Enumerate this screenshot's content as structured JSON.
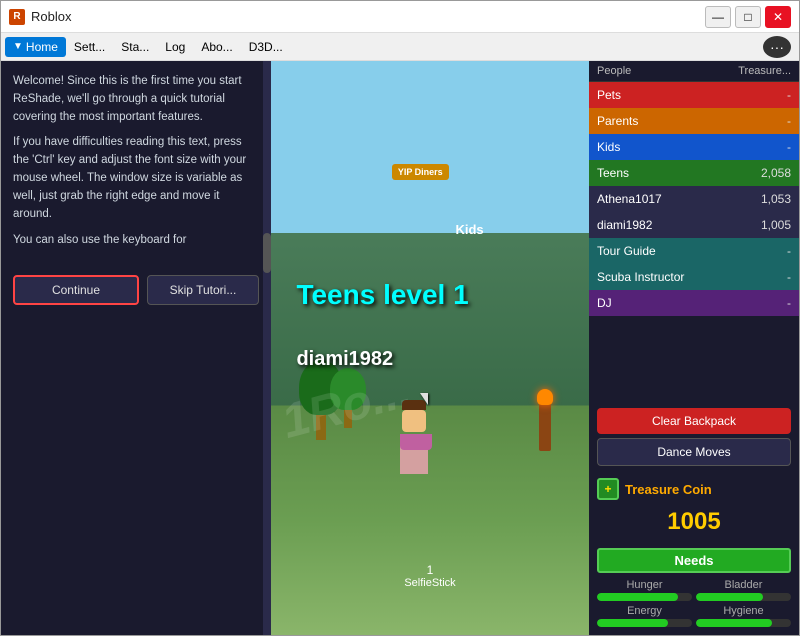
{
  "window": {
    "title": "Roblox",
    "icon": "R",
    "controls": {
      "minimize": "—",
      "maximize": "□",
      "close": "✕"
    }
  },
  "menu": {
    "tabs": [
      {
        "label": "Home",
        "active": true
      },
      {
        "label": "Sett..."
      },
      {
        "label": "Sta..."
      },
      {
        "label": "Log"
      },
      {
        "label": "Abo..."
      },
      {
        "label": "D3D..."
      }
    ],
    "more_btn": "···"
  },
  "left_panel": {
    "tutorial_paragraphs": [
      "Welcome! Since this is the first time you start ReShade, we'll go through a quick tutorial covering the most important features.",
      "If you have difficulties reading this text, press the 'Ctrl' key and adjust the font size with your mouse wheel. The window size is variable as well, just grab the right edge and move it around.",
      "You can also use the keyboard for"
    ],
    "btn_continue": "Continue",
    "btn_skip": "Skip Tutori..."
  },
  "game": {
    "level_text": "Teens level 1",
    "username": "diami1982",
    "sign_text": "YIP Diners",
    "kids_label": "Kids",
    "item_number": "1",
    "item_label": "SelfieStick",
    "watermark": "1Ro..."
  },
  "right_panel": {
    "leaderboard": {
      "col_people": "People",
      "col_treasure": "Treasure...",
      "rows": [
        {
          "name": "Pets",
          "score": "-",
          "color": "red"
        },
        {
          "name": "Parents",
          "score": "-",
          "color": "orange"
        },
        {
          "name": "Kids",
          "score": "-",
          "color": "blue"
        },
        {
          "name": "Teens",
          "score": "2,058",
          "color": "green"
        },
        {
          "name": "Athena1017",
          "score": "1,053",
          "color": "dark"
        },
        {
          "name": "diami1982",
          "score": "1,005",
          "color": "dark"
        },
        {
          "name": "Tour Guide",
          "score": "-",
          "color": "teal"
        },
        {
          "name": "Scuba Instructor",
          "score": "-",
          "color": "teal"
        },
        {
          "name": "DJ",
          "score": "-",
          "color": "purple"
        }
      ]
    },
    "btn_clear_backpack": "Clear Backpack",
    "btn_dance_moves": "Dance Moves",
    "treasure": {
      "icon": "+",
      "label": "Treasure Coin",
      "count": "1005"
    },
    "needs": {
      "header": "Needs",
      "items": [
        {
          "label": "Hunger",
          "fill": 85
        },
        {
          "label": "Bladder",
          "fill": 70
        },
        {
          "label": "Energy",
          "fill": 75
        },
        {
          "label": "Hygiene",
          "fill": 80
        }
      ]
    }
  }
}
